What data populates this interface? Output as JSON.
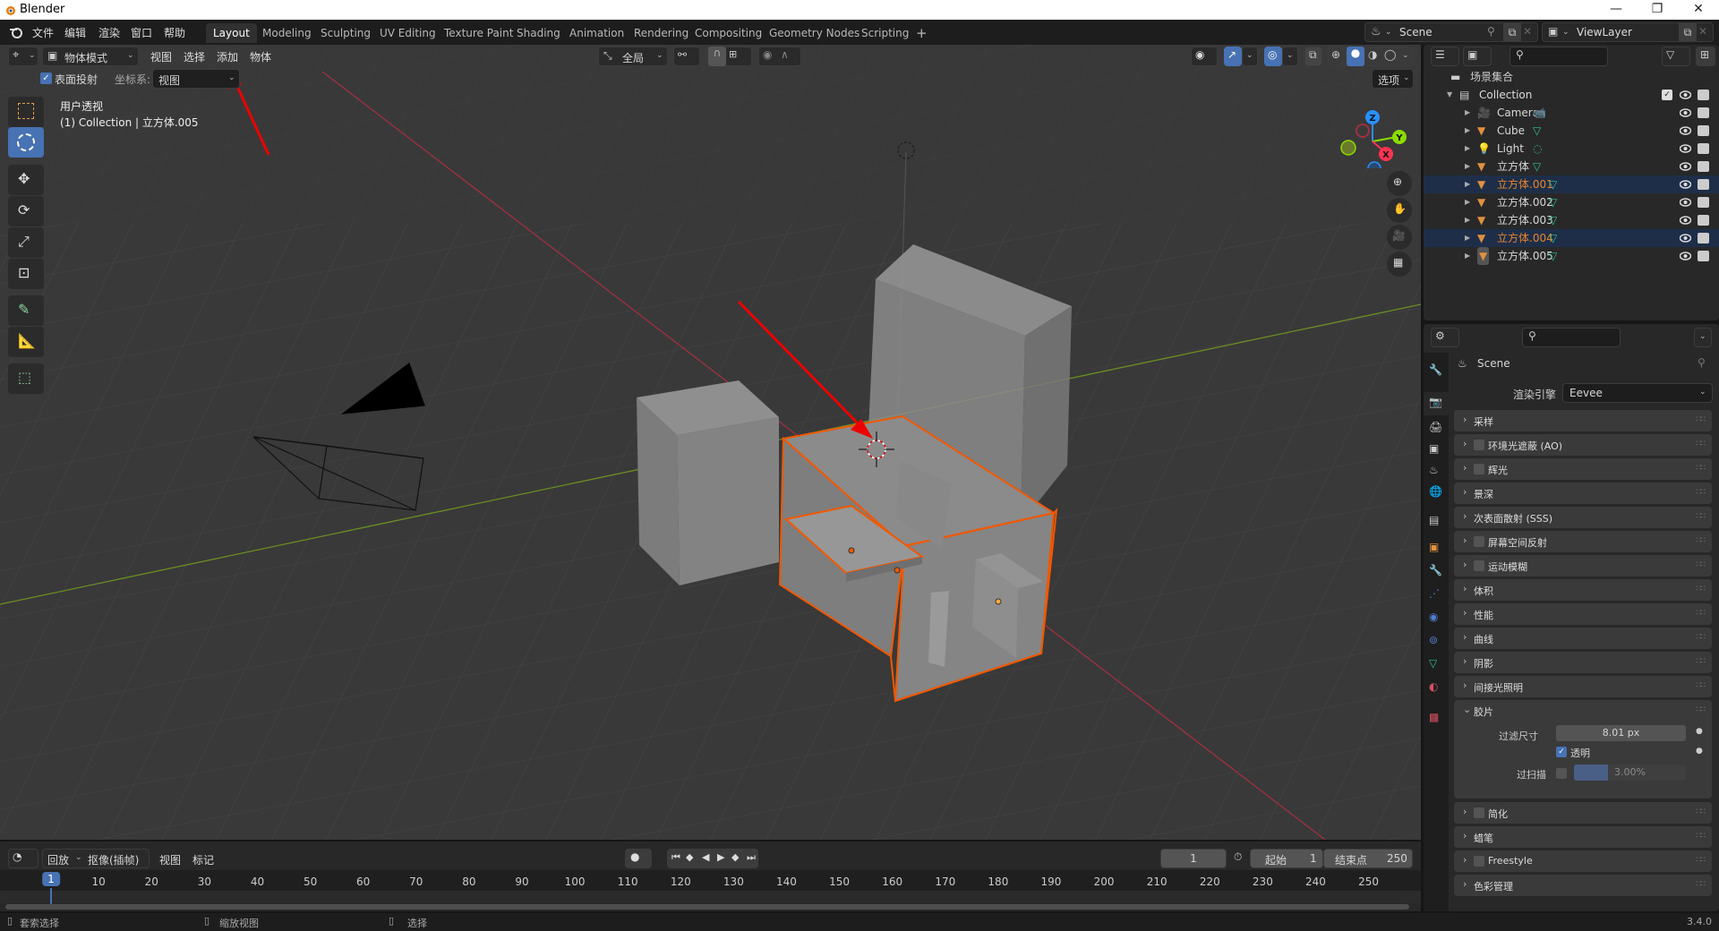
{
  "window": {
    "title": "Blender",
    "minimize": "—",
    "restore": "❐",
    "close": "✕"
  },
  "topbar": {
    "menus": [
      "文件",
      "编辑",
      "渲染",
      "窗口",
      "帮助"
    ],
    "workspaces": [
      {
        "label": "Layout",
        "active": true
      },
      {
        "label": "Modeling"
      },
      {
        "label": "Sculpting"
      },
      {
        "label": "UV Editing"
      },
      {
        "label": "Texture Paint"
      },
      {
        "label": "Shading"
      },
      {
        "label": "Animation"
      },
      {
        "label": "Rendering"
      },
      {
        "label": "Compositing"
      },
      {
        "label": "Geometry Nodes"
      },
      {
        "label": "Scripting"
      }
    ],
    "add_workspace": "+",
    "scene": "Scene",
    "view_layer": "ViewLayer"
  },
  "viewport": {
    "mode": "物体模式",
    "menus": [
      "视图",
      "选择",
      "添加",
      "物体"
    ],
    "orientation": "全局",
    "options_label": "选项",
    "surface_project_label": "表面投射",
    "surface_project_checked": true,
    "coord_label": "坐标系:",
    "coord_value": "视图",
    "overlay_title": "用户透视",
    "overlay_info": "(1) Collection | 立方体.005",
    "gizmo_axes": [
      "Z",
      "Y",
      "X"
    ],
    "colors": {
      "x": "#ff3352",
      "y": "#8bdc00",
      "z": "#2890ff",
      "selection": "#f15800",
      "active_blue": "#4772b3"
    }
  },
  "outliner": {
    "root": "场景集合",
    "collection": "Collection",
    "items": [
      {
        "name": "Camera",
        "type": "camera",
        "selected": false
      },
      {
        "name": "Cube",
        "type": "mesh",
        "selected": false
      },
      {
        "name": "Light",
        "type": "light",
        "selected": false
      },
      {
        "name": "立方体",
        "type": "mesh",
        "selected": false
      },
      {
        "name": "立方体.001",
        "type": "mesh",
        "selected": true
      },
      {
        "name": "立方体.002",
        "type": "mesh",
        "selected": false
      },
      {
        "name": "立方体.003",
        "type": "mesh",
        "selected": false
      },
      {
        "name": "立方体.004",
        "type": "mesh",
        "selected": true
      },
      {
        "name": "立方体.005",
        "type": "mesh",
        "selected": false,
        "active": true
      }
    ]
  },
  "properties": {
    "context": "Scene",
    "render_engine_label": "渲染引擎",
    "render_engine": "Eevee",
    "panels": [
      {
        "label": "采样",
        "checkbox": false
      },
      {
        "label": "环境光遮蔽 (AO)",
        "checkbox": true
      },
      {
        "label": "辉光",
        "checkbox": true
      },
      {
        "label": "景深",
        "checkbox": false
      },
      {
        "label": "次表面散射 (SSS)",
        "checkbox": false
      },
      {
        "label": "屏幕空间反射",
        "checkbox": true
      },
      {
        "label": "运动模糊",
        "checkbox": true
      },
      {
        "label": "体积",
        "checkbox": false
      },
      {
        "label": "性能",
        "checkbox": false
      },
      {
        "label": "曲线",
        "checkbox": false
      },
      {
        "label": "阴影",
        "checkbox": false
      },
      {
        "label": "间接光照明",
        "checkbox": false
      },
      {
        "label": "胶片",
        "checkbox": false,
        "expanded": true
      },
      {
        "label": "简化",
        "checkbox": true
      },
      {
        "label": "蜡笔",
        "checkbox": false
      },
      {
        "label": "Freestyle",
        "checkbox": true
      },
      {
        "label": "色彩管理",
        "checkbox": false
      }
    ],
    "film": {
      "filter_size_label": "过滤尺寸",
      "filter_size": "8.01 px",
      "transparent_label": "透明",
      "transparent_checked": true,
      "overscan_label": "过扫描",
      "overscan": "3.00%",
      "overscan_fraction": 0.3
    }
  },
  "timeline": {
    "playback": "回放",
    "keying": "抠像(插帧)",
    "menus": [
      "视图",
      "标记"
    ],
    "current_frame": "1",
    "start_label": "起始",
    "start": "1",
    "end_label": "结束点",
    "end": "250",
    "ticks": [
      "1",
      "10",
      "20",
      "30",
      "40",
      "50",
      "60",
      "70",
      "80",
      "90",
      "100",
      "110",
      "120",
      "130",
      "140",
      "150",
      "160",
      "170",
      "180",
      "190",
      "200",
      "210",
      "220",
      "230",
      "240",
      "250"
    ]
  },
  "statusbar": {
    "items": [
      "套索选择",
      "缩放视图",
      "选择"
    ],
    "version": "3.4.0"
  }
}
